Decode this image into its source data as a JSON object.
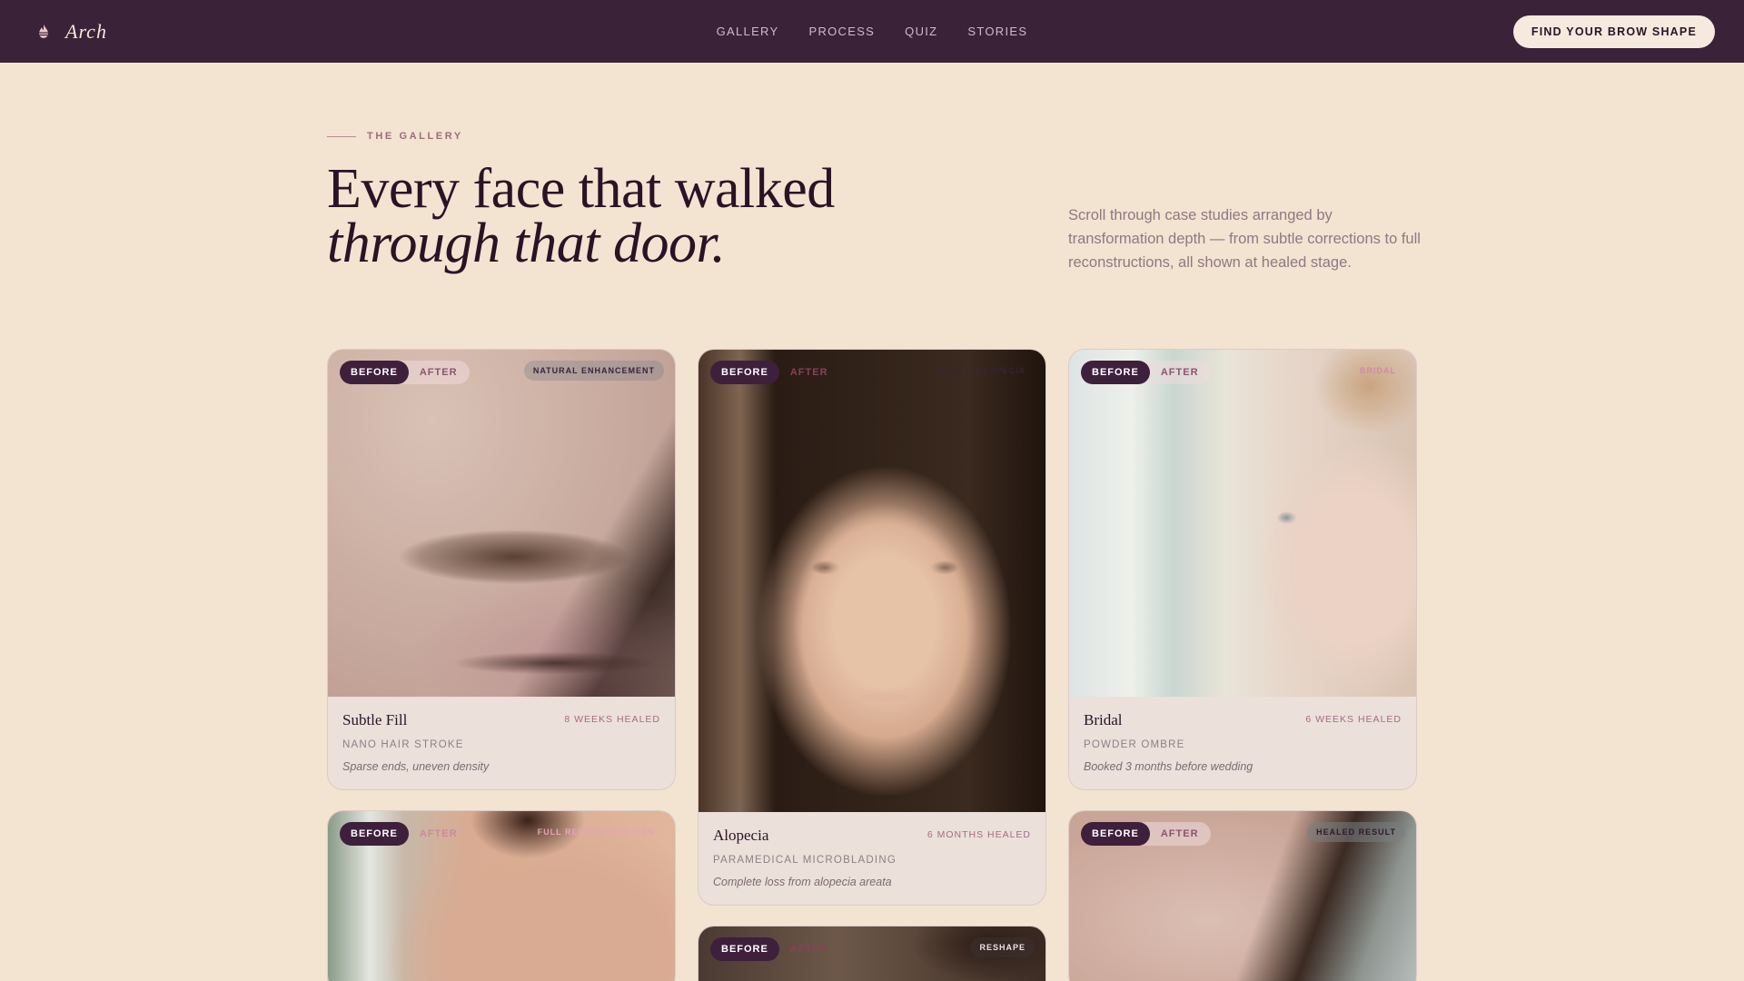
{
  "nav": {
    "brand": "Arch",
    "links": [
      "GALLERY",
      "PROCESS",
      "QUIZ",
      "STORIES"
    ],
    "cta": "FIND YOUR BROW SHAPE"
  },
  "header": {
    "eyebrow": "THE GALLERY",
    "headline_line1": "Every face that walked",
    "headline_line2": "through that door.",
    "intro": "Scroll through case studies arranged by transformation depth — from subtle corrections to full reconstructions, all shown at healed stage."
  },
  "toggle": {
    "before": "BEFORE",
    "after": "AFTER"
  },
  "cards": [
    {
      "tag": "NATURAL ENHANCEMENT",
      "title": "Subtle Fill",
      "healed": "8 WEEKS HEALED",
      "technique": "NANO HAIR STROKE",
      "note": "Sparse ends, uneven density"
    },
    {
      "tag": "SCAR & ALOPECIA",
      "title": "Alopecia",
      "healed": "6 MONTHS HEALED",
      "technique": "PARAMEDICAL MICROBLADING",
      "note": "Complete loss from alopecia areata"
    },
    {
      "tag": "BRIDAL",
      "title": "Bridal",
      "healed": "6 WEEKS HEALED",
      "technique": "POWDER OMBRE",
      "note": "Booked 3 months before wedding"
    },
    {
      "tag": "FULL RECONSTRUCTION"
    },
    {
      "tag": "RESHAPE"
    },
    {
      "tag": "HEALED RESULT"
    }
  ],
  "icons": {
    "brand": "flame-icon"
  },
  "colors": {
    "nav_bg": "#3a2239",
    "page_bg": "#f3e3d1",
    "accent": "#3e1f3c"
  }
}
